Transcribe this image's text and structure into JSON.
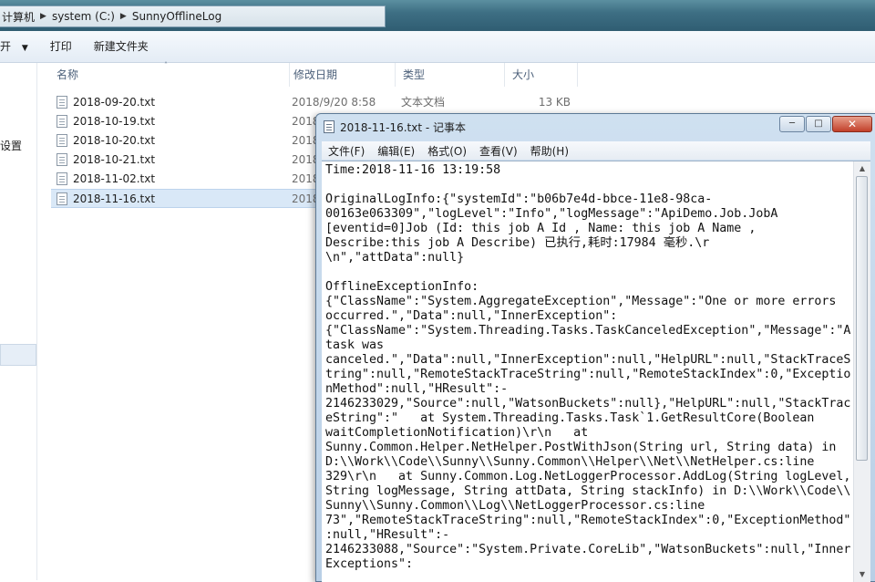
{
  "explorer": {
    "address": {
      "root": "计算机",
      "crumbs": [
        "system (C:)",
        "SunnyOfflineLog"
      ]
    },
    "toolbar": {
      "open": "开",
      "print": "打印",
      "new_folder": "新建文件夹"
    },
    "left_pane": {
      "settings": "设置"
    },
    "columns": {
      "name": "名称",
      "modified": "修改日期",
      "type": "类型",
      "size": "大小"
    },
    "files": [
      {
        "name": "2018-09-20.txt",
        "date": "2018/9/20 8:58",
        "type": "文本文档",
        "size": "13 KB"
      },
      {
        "name": "2018-10-19.txt",
        "date": "2018",
        "type": "",
        "size": ""
      },
      {
        "name": "2018-10-20.txt",
        "date": "2018",
        "type": "",
        "size": ""
      },
      {
        "name": "2018-10-21.txt",
        "date": "2018",
        "type": "",
        "size": ""
      },
      {
        "name": "2018-11-02.txt",
        "date": "2018",
        "type": "",
        "size": ""
      },
      {
        "name": "2018-11-16.txt",
        "date": "2018",
        "type": "",
        "size": ""
      }
    ],
    "selected_file": "2018-11-16.txt"
  },
  "notepad": {
    "title": "2018-11-16.txt - 记事本",
    "menu": [
      "文件(F)",
      "编辑(E)",
      "格式(O)",
      "查看(V)",
      "帮助(H)"
    ],
    "content": "Time:2018-11-16 13:19:58\n\nOriginalLogInfo:{\"systemId\":\"b06b7e4d-bbce-11e8-98ca-\n00163e063309\",\"logLevel\":\"Info\",\"logMessage\":\"ApiDemo.Job.JobA\n[eventid=0]Job (Id: this job A Id , Name: this job A Name ,\nDescribe:this job A Describe) 已执行,耗时:17984 毫秒.\\r\n\\n\",\"attData\":null}\n\nOfflineExceptionInfo:\n{\"ClassName\":\"System.AggregateException\",\"Message\":\"One or more errors\noccurred.\",\"Data\":null,\"InnerException\":\n{\"ClassName\":\"System.Threading.Tasks.TaskCanceledException\",\"Message\":\"A\ntask was\ncanceled.\",\"Data\":null,\"InnerException\":null,\"HelpURL\":null,\"StackTraceS\ntring\":null,\"RemoteStackTraceString\":null,\"RemoteStackIndex\":0,\"Exceptio\nnMethod\":null,\"HResult\":-\n2146233029,\"Source\":null,\"WatsonBuckets\":null},\"HelpURL\":null,\"StackTrac\neString\":\"   at System.Threading.Tasks.Task`1.GetResultCore(Boolean\nwaitCompletionNotification)\\r\\n   at\nSunny.Common.Helper.NetHelper.PostWithJson(String url, String data) in\nD:\\\\Work\\\\Code\\\\Sunny\\\\Sunny.Common\\\\Helper\\\\Net\\\\NetHelper.cs:line\n329\\r\\n   at Sunny.Common.Log.NetLoggerProcessor.AddLog(String logLevel,\nString logMessage, String attData, String stackInfo) in D:\\\\Work\\\\Code\\\\\nSunny\\\\Sunny.Common\\\\Log\\\\NetLoggerProcessor.cs:line\n73\",\"RemoteStackTraceString\":null,\"RemoteStackIndex\":0,\"ExceptionMethod\"\n:null,\"HResult\":-\n2146233088,\"Source\":\"System.Private.CoreLib\",\"WatsonBuckets\":null,\"Inner\nExceptions\":"
  }
}
